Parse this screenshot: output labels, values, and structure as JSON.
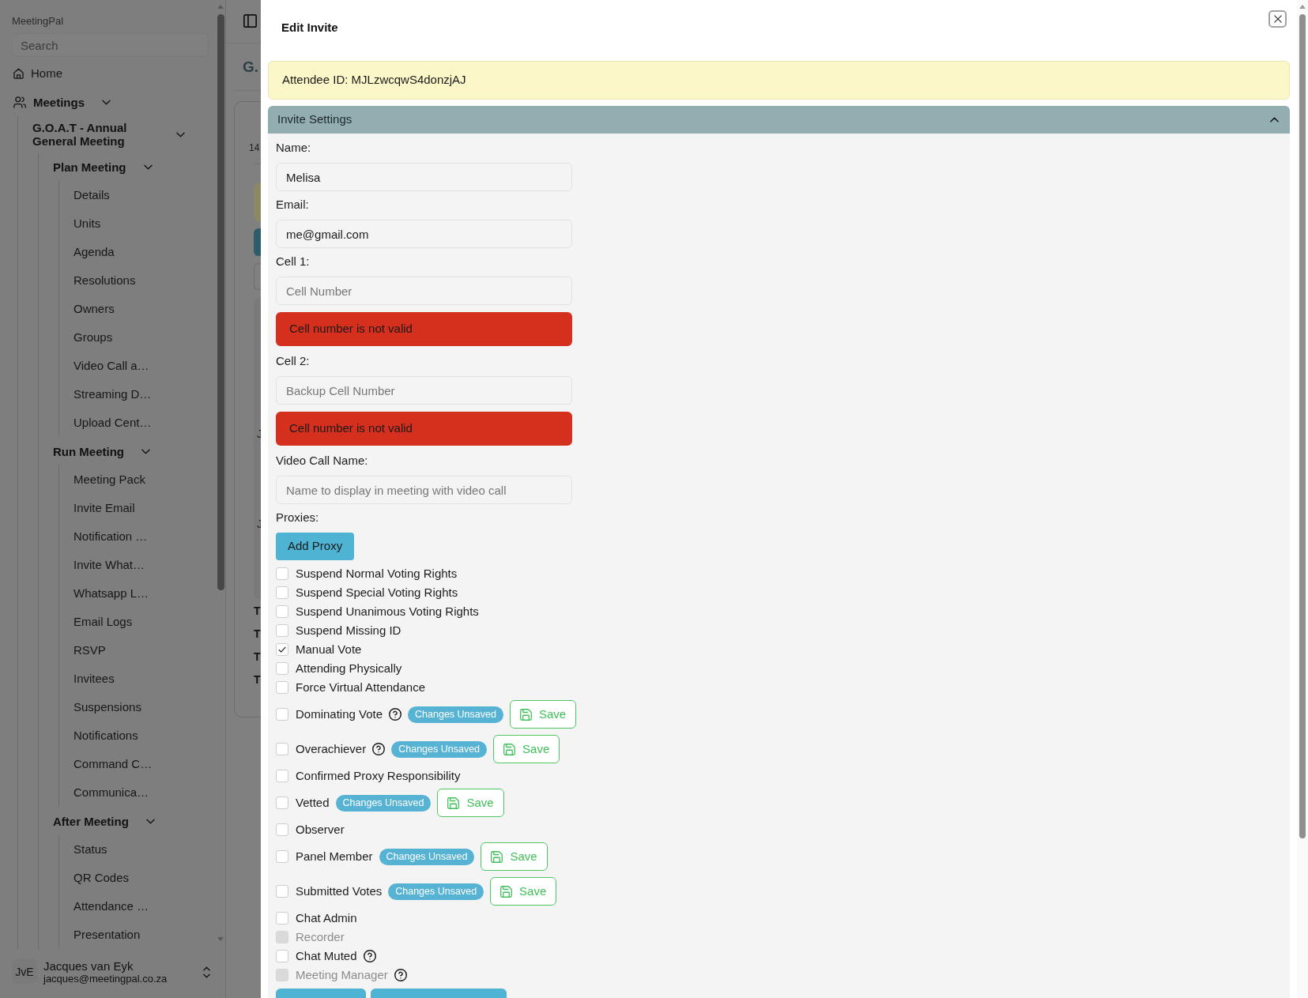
{
  "sidebar": {
    "brand": "MeetingPal",
    "search": {
      "placeholder": "Search"
    },
    "nav": [
      {
        "label": "Home"
      },
      {
        "label": "Meetings",
        "expanded": true,
        "children": [
          {
            "label": "G.O.A.T - Annual General Meeting",
            "expanded": true,
            "children": [
              {
                "label": "Plan Meeting",
                "expanded": true,
                "children": [
                  {
                    "label": "Details"
                  },
                  {
                    "label": "Units"
                  },
                  {
                    "label": "Agenda"
                  },
                  {
                    "label": "Resolutions"
                  },
                  {
                    "label": "Owners"
                  },
                  {
                    "label": "Groups"
                  },
                  {
                    "label": "Video Call a…"
                  },
                  {
                    "label": "Streaming D…"
                  },
                  {
                    "label": "Upload Cent…"
                  }
                ]
              },
              {
                "label": "Run Meeting",
                "expanded": true,
                "children": [
                  {
                    "label": "Meeting Pack"
                  },
                  {
                    "label": "Invite Email"
                  },
                  {
                    "label": "Notification …"
                  },
                  {
                    "label": "Invite What…"
                  },
                  {
                    "label": "Whatsapp L…"
                  },
                  {
                    "label": "Email Logs"
                  },
                  {
                    "label": "RSVP"
                  },
                  {
                    "label": "Invitees"
                  },
                  {
                    "label": "Suspensions"
                  },
                  {
                    "label": "Notifications"
                  },
                  {
                    "label": "Command C…"
                  },
                  {
                    "label": "Communica…"
                  }
                ]
              },
              {
                "label": "After Meeting",
                "expanded": true,
                "children": [
                  {
                    "label": "Status"
                  },
                  {
                    "label": "QR Codes"
                  },
                  {
                    "label": "Attendance …"
                  },
                  {
                    "label": "Presentation"
                  }
                ]
              }
            ]
          }
        ]
      }
    ],
    "user": {
      "initials": "JvE",
      "name": "Jacques van Eyk",
      "email": "jacques@meetingpal.co.za"
    }
  },
  "background": {
    "heading": "G.",
    "card": {
      "label": "14",
      "rows": [
        "J",
        "J"
      ],
      "row_labels": [
        "T",
        "T",
        "T",
        "T"
      ]
    }
  },
  "dialog": {
    "title": "Edit Invite",
    "notice": "Attendee ID: MJLzwcqwS4donzjAJ",
    "section": {
      "title": "Invite Settings",
      "expanded": true,
      "fields": [
        {
          "label": "Name:",
          "value": "Melisa"
        },
        {
          "label": "Email:",
          "value": "me@gmail.com"
        },
        {
          "label": "Cell 1:",
          "placeholder": "Cell Number",
          "error": "Cell number is not valid"
        },
        {
          "label": "Cell 2:",
          "placeholder": "Backup Cell Number",
          "error": "Cell number is not valid"
        },
        {
          "label": "Video Call Name:",
          "placeholder": "Name to display in meeting with video call"
        }
      ],
      "proxies": {
        "label": "Proxies:",
        "button": "Add Proxy"
      },
      "options": [
        {
          "label": "Suspend Normal Voting Rights",
          "checked": false,
          "disabled": false,
          "help": false
        },
        {
          "label": "Suspend Special Voting Rights",
          "checked": false,
          "disabled": false,
          "help": false
        },
        {
          "label": "Suspend Unanimous Voting Rights",
          "checked": false,
          "disabled": false,
          "help": false
        },
        {
          "label": "Suspend Missing ID",
          "checked": false,
          "disabled": false,
          "help": false
        },
        {
          "label": "Manual Vote",
          "checked": true,
          "disabled": false,
          "help": false
        },
        {
          "label": "Attending Physically",
          "checked": false,
          "disabled": false,
          "help": false
        },
        {
          "label": "Force Virtual Attendance",
          "checked": false,
          "disabled": false,
          "help": false
        },
        {
          "label": "Dominating Vote",
          "checked": false,
          "disabled": false,
          "help": true,
          "status": "Changes Unsaved",
          "save": "Save"
        },
        {
          "label": "Overachiever",
          "checked": false,
          "disabled": false,
          "help": true,
          "status": "Changes Unsaved",
          "save": "Save"
        },
        {
          "label": "Confirmed Proxy Responsibility",
          "checked": false,
          "disabled": false,
          "help": false
        },
        {
          "label": "Vetted",
          "checked": false,
          "disabled": false,
          "help": false,
          "status": "Changes Unsaved",
          "save": "Save"
        },
        {
          "label": "Observer",
          "checked": false,
          "disabled": false,
          "help": false
        },
        {
          "label": "Panel Member",
          "checked": false,
          "disabled": false,
          "help": false,
          "status": "Changes Unsaved",
          "save": "Save"
        },
        {
          "label": "Submitted Votes",
          "checked": false,
          "disabled": false,
          "help": false,
          "status": "Changes Unsaved",
          "save": "Save"
        },
        {
          "label": "Chat Admin",
          "checked": false,
          "disabled": false,
          "help": false
        },
        {
          "label": "Recorder",
          "checked": false,
          "disabled": true,
          "help": false
        },
        {
          "label": "Chat Muted",
          "checked": false,
          "disabled": false,
          "help": true
        },
        {
          "label": "Meeting Manager",
          "checked": false,
          "disabled": true,
          "help": true
        }
      ],
      "actions": [
        {
          "kind": "filled"
        },
        {
          "kind": "filled"
        }
      ]
    }
  }
}
